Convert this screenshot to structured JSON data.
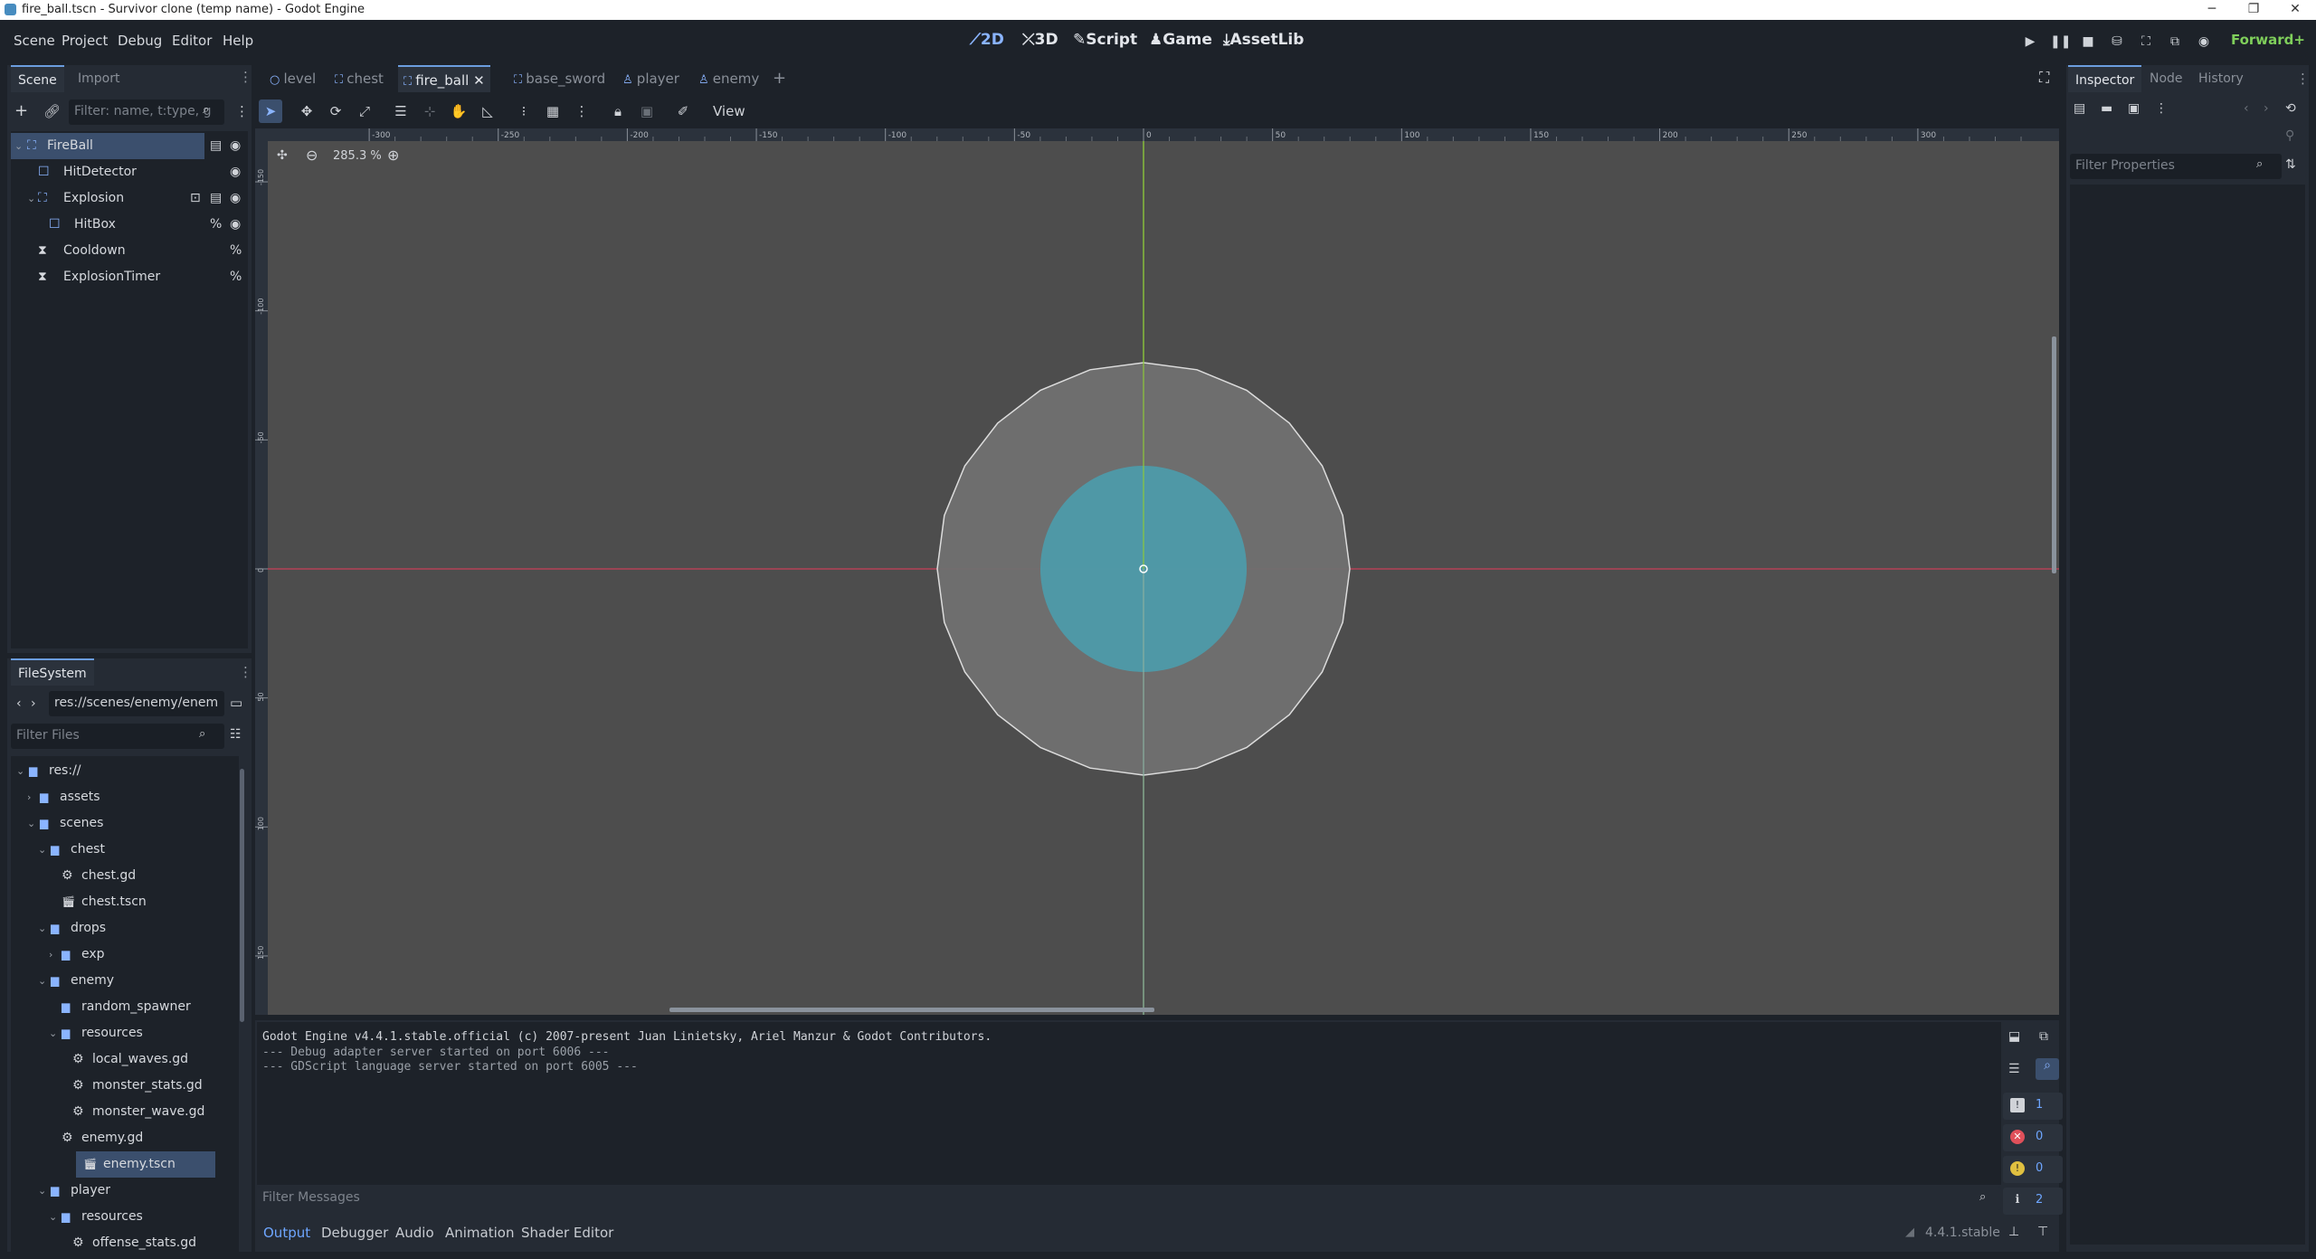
{
  "window": {
    "title": "fire_ball.tscn - Survivor clone (temp name) - Godot Engine",
    "controls": [
      "─",
      "❐",
      "✕"
    ]
  },
  "menu": [
    "Scene",
    "Project",
    "Debug",
    "Editor",
    "Help"
  ],
  "modes": [
    {
      "label": "2D",
      "icon": "2d-icon",
      "glyph": "⟋"
    },
    {
      "label": "3D",
      "icon": "3d-icon",
      "glyph": "⤫"
    },
    {
      "label": "Script",
      "icon": "script-icon",
      "glyph": "✎"
    },
    {
      "label": "Game",
      "icon": "game-icon",
      "glyph": "♟"
    },
    {
      "label": "AssetLib",
      "icon": "assetlib-icon",
      "glyph": "⤓"
    }
  ],
  "renderer": "Forward+",
  "scene_dock": {
    "tabs": [
      "Scene",
      "Import"
    ],
    "filter_placeholder": "Filter: name, t:type, g",
    "nodes": [
      {
        "name": "FireBall",
        "icon": "node2d-icon"
      },
      {
        "name": "HitDetector",
        "icon": "area2d-icon"
      },
      {
        "name": "Explosion",
        "icon": "node2d-icon"
      },
      {
        "name": "HitBox",
        "icon": "area2d-icon"
      },
      {
        "name": "Cooldown",
        "icon": "timer-icon"
      },
      {
        "name": "ExplosionTimer",
        "icon": "timer-icon"
      }
    ]
  },
  "filesystem": {
    "tab": "FileSystem",
    "path": "res://scenes/enemy/enem",
    "filter_placeholder": "Filter Files",
    "items": [
      {
        "label": "res://",
        "type": "folder"
      },
      {
        "label": "assets",
        "type": "folder"
      },
      {
        "label": "scenes",
        "type": "folder"
      },
      {
        "label": "chest",
        "type": "folder"
      },
      {
        "label": "chest.gd",
        "type": "script"
      },
      {
        "label": "chest.tscn",
        "type": "scene"
      },
      {
        "label": "drops",
        "type": "folder"
      },
      {
        "label": "exp",
        "type": "folder"
      },
      {
        "label": "enemy",
        "type": "folder"
      },
      {
        "label": "random_spawner",
        "type": "folder"
      },
      {
        "label": "resources",
        "type": "folder"
      },
      {
        "label": "local_waves.gd",
        "type": "script"
      },
      {
        "label": "monster_stats.gd",
        "type": "script"
      },
      {
        "label": "monster_wave.gd",
        "type": "script"
      },
      {
        "label": "enemy.gd",
        "type": "script"
      },
      {
        "label": "enemy.tscn",
        "type": "scene"
      },
      {
        "label": "player",
        "type": "folder"
      },
      {
        "label": "resources",
        "type": "folder"
      },
      {
        "label": "offense_stats.gd",
        "type": "script"
      }
    ]
  },
  "editor_tabs": [
    {
      "label": "level",
      "icon": "node-icon"
    },
    {
      "label": "chest",
      "icon": "node2d-icon"
    },
    {
      "label": "fire_ball",
      "icon": "node2d-icon"
    },
    {
      "label": "base_sword",
      "icon": "node2d-icon"
    },
    {
      "label": "player",
      "icon": "character-icon"
    },
    {
      "label": "enemy",
      "icon": "character-icon"
    }
  ],
  "toolbar": {
    "view_label": "View"
  },
  "viewport": {
    "zoom": "285.3 %",
    "ruler_h": [
      "-300",
      "-250",
      "-200",
      "-150",
      "-100",
      "-50",
      "0",
      "50",
      "100",
      "150",
      "200",
      "250",
      "300"
    ],
    "ruler_v": [
      "-150",
      "-100",
      "-50",
      "0",
      "50",
      "100",
      "150"
    ]
  },
  "output": {
    "lines": [
      "Godot Engine v4.4.1.stable.official (c) 2007-present Juan Linietsky, Ariel Manzur & Godot Contributors.",
      "--- Debug adapter server started on port 6006 ---",
      "--- GDScript language server started on port 6005 ---"
    ],
    "filter_placeholder": "Filter Messages",
    "counts": {
      "log": "1",
      "errors": "0",
      "warnings": "0",
      "info": "2"
    }
  },
  "bottom_tabs": [
    "Output",
    "Debugger",
    "Audio",
    "Animation",
    "Shader Editor"
  ],
  "version": "4.4.1.stable",
  "inspector": {
    "tabs": [
      "Inspector",
      "Node",
      "History"
    ],
    "filter_placeholder": "Filter Properties"
  },
  "colors": {
    "accent": "#6b9dde",
    "viewport_bg": "#4d4d4d",
    "explosion_fill": "#707070",
    "hitbox_fill": "#4aa0b0",
    "axis_x": "#c8405a",
    "axis_y": "#8cc83a"
  }
}
